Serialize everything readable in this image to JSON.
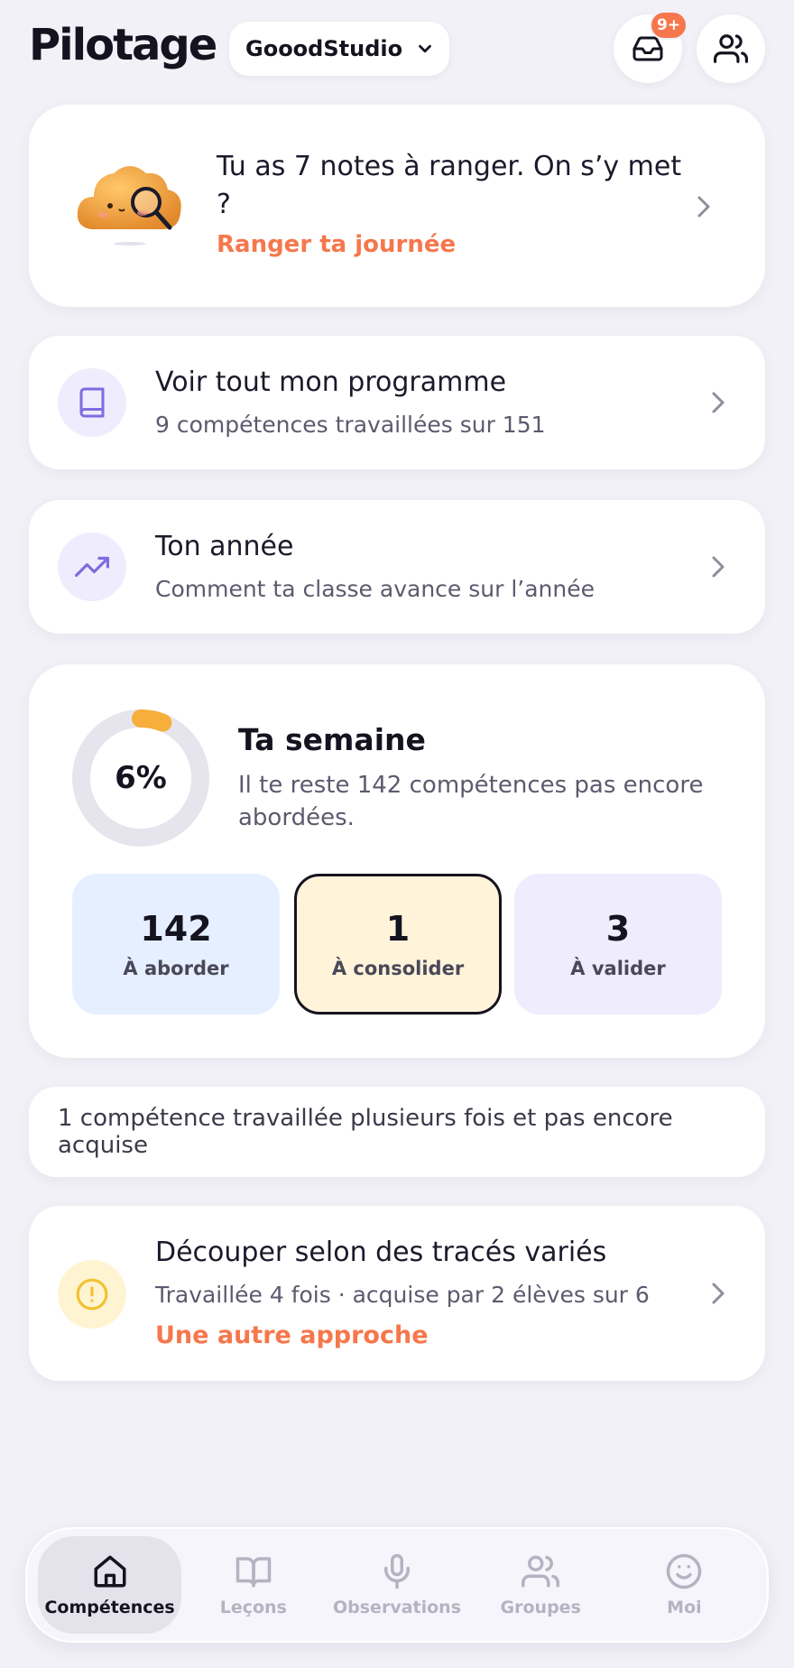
{
  "header": {
    "title": "Pilotage",
    "org_name": "GooodStudio",
    "inbox_badge": "9+"
  },
  "notes_card": {
    "text": "Tu as 7 notes à ranger. On s’y met ?",
    "link": "Ranger ta journée"
  },
  "program_card": {
    "title": "Voir tout mon programme",
    "subtitle": "9 compétences travaillées sur 151"
  },
  "year_card": {
    "title": "Ton année",
    "subtitle": "Comment ta classe avance sur l’année"
  },
  "week_card": {
    "progress_label": "6%",
    "progress_value": 0.06,
    "title": "Ta semaine",
    "subtitle": "Il te reste 142 compétences pas encore abordées.",
    "stats": [
      {
        "value": "142",
        "label": "À aborder"
      },
      {
        "value": "1",
        "label": "À consolider"
      },
      {
        "value": "3",
        "label": "À valider"
      }
    ]
  },
  "info_strip": "1 compétence travaillée plusieurs fois et pas encore acquise",
  "skill_card": {
    "title": "Découper selon des tracés variés",
    "subtitle": "Travaillée 4 fois · acquise par 2 élèves sur 6",
    "link": "Une autre approche"
  },
  "nav": {
    "items": [
      {
        "label": "Compétences",
        "icon": "home-icon"
      },
      {
        "label": "Leçons",
        "icon": "book-open-icon"
      },
      {
        "label": "Observations",
        "icon": "microphone-icon"
      },
      {
        "label": "Groupes",
        "icon": "users-icon"
      },
      {
        "label": "Moi",
        "icon": "smile-icon"
      }
    ]
  },
  "colors": {
    "accent": "#f6774c",
    "purple": "#7e6ce0",
    "progress": "#f7ae3b",
    "stat_blue": "#e6efff",
    "stat_yellow": "#fff3da",
    "stat_purple": "#eeecfd"
  }
}
